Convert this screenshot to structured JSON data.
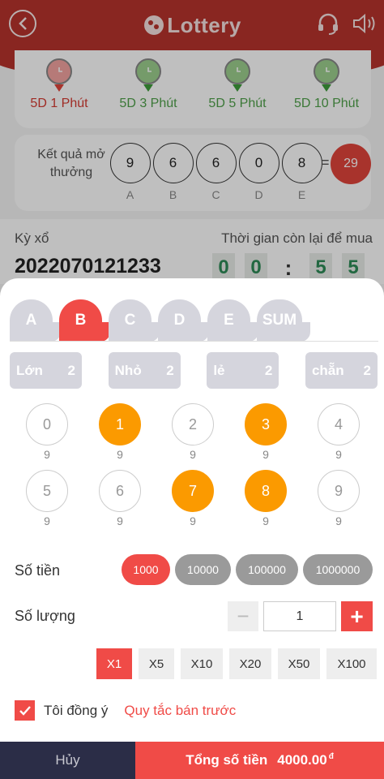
{
  "header": {
    "title": "Lottery",
    "back_icon": "back-icon",
    "support_icon": "headset-icon",
    "sound_icon": "speaker-icon"
  },
  "games": [
    {
      "label": "5D 1 Phút",
      "active": true
    },
    {
      "label": "5D 3 Phút",
      "active": false
    },
    {
      "label": "5D 5 Phút",
      "active": false
    },
    {
      "label": "5D 10 Phút",
      "active": false
    }
  ],
  "result": {
    "label": "Kết quả mở thưởng",
    "balls": [
      {
        "value": "9",
        "letter": "A"
      },
      {
        "value": "6",
        "letter": "B"
      },
      {
        "value": "6",
        "letter": "C"
      },
      {
        "value": "0",
        "letter": "D"
      },
      {
        "value": "8",
        "letter": "E"
      }
    ],
    "equals": "=",
    "sum": "29"
  },
  "period": {
    "label": "Kỳ xổ",
    "value": "2022070121233",
    "remaining_label": "Thời gian còn lại để mua",
    "timer": [
      "0",
      "0",
      ":",
      "5",
      "5"
    ]
  },
  "tabs": [
    {
      "label": "A",
      "active": false
    },
    {
      "label": "B",
      "active": true
    },
    {
      "label": "C",
      "active": false
    },
    {
      "label": "D",
      "active": false
    },
    {
      "label": "E",
      "active": false
    },
    {
      "label": "SUM",
      "active": false
    }
  ],
  "big_small": [
    {
      "label": "Lớn",
      "odds": "2"
    },
    {
      "label": "Nhỏ",
      "odds": "2"
    },
    {
      "label": "lẻ",
      "odds": "2"
    },
    {
      "label": "chẵn",
      "odds": "2"
    }
  ],
  "numbers": [
    {
      "n": "0",
      "odds": "9",
      "selected": false
    },
    {
      "n": "1",
      "odds": "9",
      "selected": true
    },
    {
      "n": "2",
      "odds": "9",
      "selected": false
    },
    {
      "n": "3",
      "odds": "9",
      "selected": true
    },
    {
      "n": "4",
      "odds": "9",
      "selected": false
    },
    {
      "n": "5",
      "odds": "9",
      "selected": false
    },
    {
      "n": "6",
      "odds": "9",
      "selected": false
    },
    {
      "n": "7",
      "odds": "9",
      "selected": true
    },
    {
      "n": "8",
      "odds": "9",
      "selected": true
    },
    {
      "n": "9",
      "odds": "9",
      "selected": false
    }
  ],
  "money": {
    "label": "Số tiền",
    "options": [
      {
        "label": "1000",
        "active": true
      },
      {
        "label": "10000",
        "active": false
      },
      {
        "label": "100000",
        "active": false
      },
      {
        "label": "1000000",
        "active": false
      }
    ]
  },
  "quantity": {
    "label": "Số lượng",
    "minus": "−",
    "value": "1",
    "plus": "+"
  },
  "multipliers": [
    {
      "label": "X1",
      "active": true
    },
    {
      "label": "X5",
      "active": false
    },
    {
      "label": "X10",
      "active": false
    },
    {
      "label": "X20",
      "active": false
    },
    {
      "label": "X50",
      "active": false
    },
    {
      "label": "X100",
      "active": false
    }
  ],
  "agree": {
    "checked": true,
    "text": "Tôi đồng ý",
    "rules_link": "Quy tắc bán trước"
  },
  "footer": {
    "cancel": "Hủy",
    "total_label": "Tổng số tiền",
    "total_value": "4000.00",
    "currency": "đ"
  },
  "colors": {
    "accent": "#f04b47",
    "selected_number": "#fb9a00",
    "header": "#b7332d",
    "dark": "#2b2d47"
  }
}
